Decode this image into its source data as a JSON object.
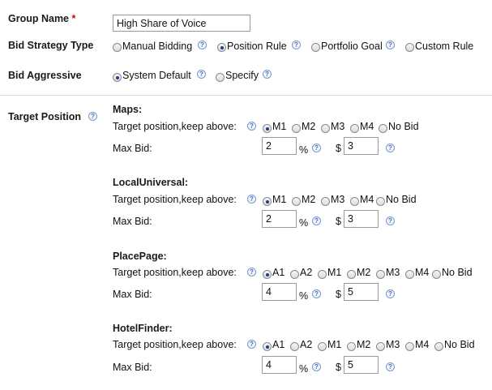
{
  "form": {
    "group_name_label": "Group Name",
    "required_mark": "*",
    "group_name_value": "High Share of Voice",
    "bid_strategy_label": "Bid Strategy Type",
    "bid_strategy_options": [
      "Manual Bidding",
      "Position Rule",
      "Portfolio Goal",
      "Custom Rule"
    ],
    "bid_strategy_selected": "Position Rule",
    "bid_aggressive_label": "Bid Aggressive",
    "bid_aggressive_options": [
      "System Default",
      "Specify"
    ],
    "bid_aggressive_selected": "System Default",
    "target_position_label": "Target Position",
    "help_glyph": "?"
  },
  "sections": [
    {
      "title": "Maps:",
      "target_label": "Target position,keep above:",
      "options": [
        "M1",
        "M2",
        "M3",
        "M4",
        "No Bid"
      ],
      "selected": "M1",
      "max_bid_label": "Max Bid:",
      "percent_value": "2",
      "percent_unit": "%",
      "currency_symbol": "$",
      "dollar_value": "3"
    },
    {
      "title": "LocalUniversal:",
      "target_label": "Target position,keep above:",
      "options": [
        "M1",
        "M2",
        "M3",
        "M4",
        "No Bid"
      ],
      "selected": "M1",
      "max_bid_label": "Max Bid:",
      "percent_value": "2",
      "percent_unit": "%",
      "currency_symbol": "$",
      "dollar_value": "3"
    },
    {
      "title": "PlacePage:",
      "target_label": "Target position,keep above:",
      "options": [
        "A1",
        "A2",
        "M1",
        "M2",
        "M3",
        "M4",
        "No Bid"
      ],
      "selected": "A1",
      "max_bid_label": "Max Bid:",
      "percent_value": "4",
      "percent_unit": "%",
      "currency_symbol": "$",
      "dollar_value": "5"
    },
    {
      "title": "HotelFinder:",
      "target_label": "Target position,keep above:",
      "options": [
        "A1",
        "A2",
        "M1",
        "M2",
        "M3",
        "M4",
        "No Bid"
      ],
      "selected": "A1",
      "max_bid_label": "Max Bid:",
      "percent_value": "4",
      "percent_unit": "%",
      "currency_symbol": "$",
      "dollar_value": "5"
    }
  ]
}
